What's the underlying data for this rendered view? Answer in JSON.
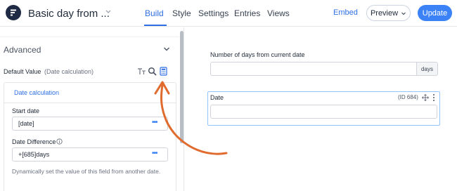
{
  "header": {
    "form_title": "Basic day from ...",
    "tabs": [
      {
        "label": "Build",
        "active": true
      },
      {
        "label": "Style",
        "active": false
      },
      {
        "label": "Settings",
        "active": false
      },
      {
        "label": "Entries",
        "active": false
      },
      {
        "label": "Views",
        "active": false
      }
    ],
    "embed_label": "Embed",
    "preview_label": "Preview",
    "update_label": "Update",
    "accent_color": "#2f6fe4"
  },
  "sidebar": {
    "section_title": "Advanced",
    "default_value_label": "Default Value",
    "default_value_sub": "(Date calculation)",
    "icons": [
      "text-format-icon",
      "search-icon",
      "calculator-icon"
    ],
    "calc_tab_label": "Date calculation",
    "start_date": {
      "label": "Start date",
      "value": "[date]"
    },
    "date_difference": {
      "label": "Date Difference",
      "value": "+[685]days"
    },
    "helper_text": "Dynamically set the value of this field from another date."
  },
  "canvas": {
    "days_field": {
      "label": "Number of days from current date",
      "suffix": "days",
      "value": ""
    },
    "date_field": {
      "label": "Date",
      "id_text": "(ID 684)",
      "value": ""
    }
  },
  "annotation": {
    "arrow_color": "#e06b2e"
  }
}
